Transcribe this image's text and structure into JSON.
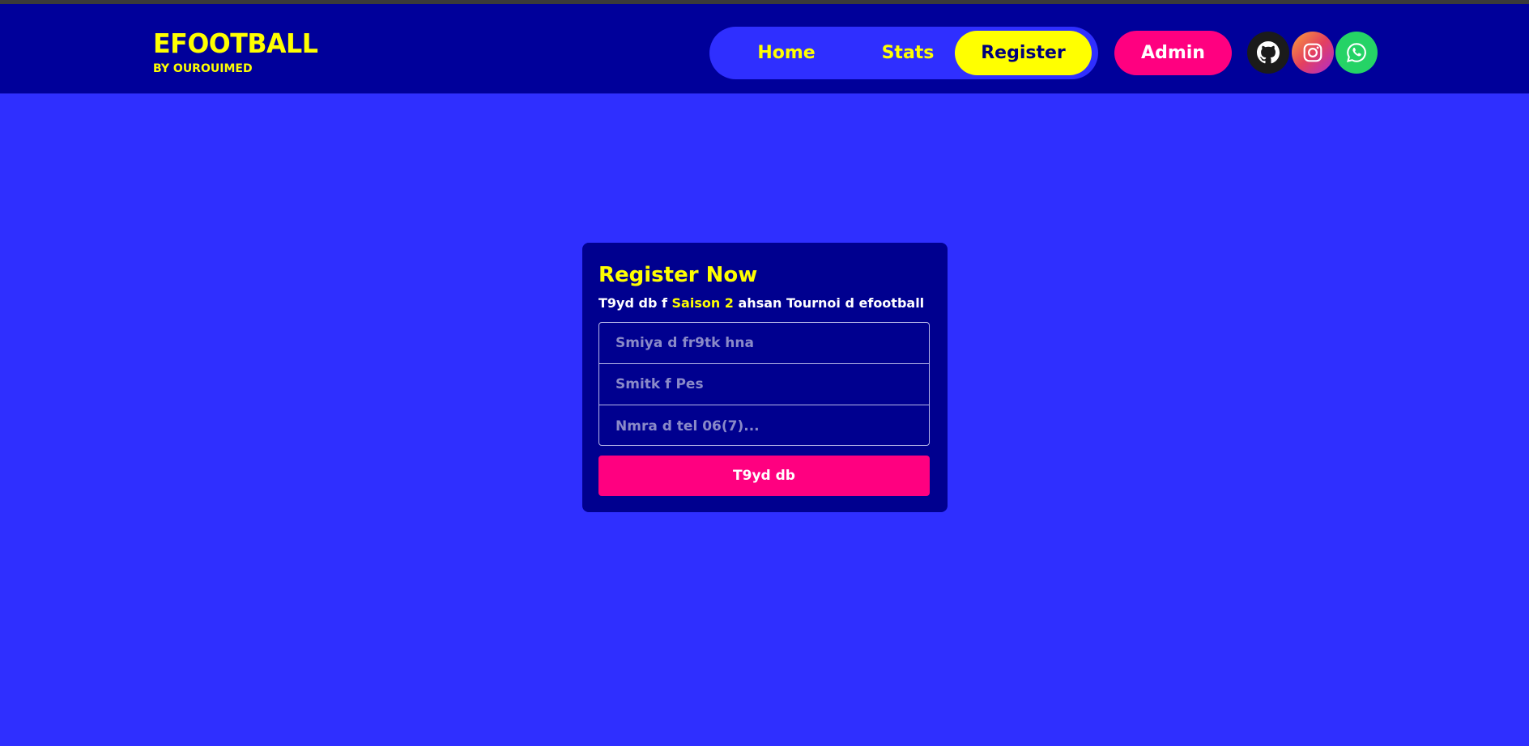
{
  "brand": {
    "title": "EFOOTBALL",
    "subtitle": "BY OUROUIMED"
  },
  "nav": {
    "items": [
      {
        "label": "Home"
      },
      {
        "label": "Stats"
      },
      {
        "label": "Register",
        "active": true
      }
    ],
    "admin_label": "Admin"
  },
  "social": {
    "icons": [
      "github-icon",
      "instagram-icon",
      "whatsapp-icon"
    ]
  },
  "register_card": {
    "title": "Register Now",
    "subtitle_before": "T9yd db f ",
    "subtitle_highlight": "Saison 2",
    "subtitle_after": " ahsan Tournoi d efootball",
    "fields": {
      "name_placeholder": "Smiya d fr9tk hna",
      "pes_placeholder": "Smitk f Pes",
      "phone_placeholder": "Nmra d tel 06(7)..."
    },
    "submit_label": "T9yd db"
  },
  "colors": {
    "background": "#2f2fff",
    "header": "#00009a",
    "accent_yellow": "#ffff00",
    "accent_pink": "#ff0080",
    "card": "#00008f"
  }
}
